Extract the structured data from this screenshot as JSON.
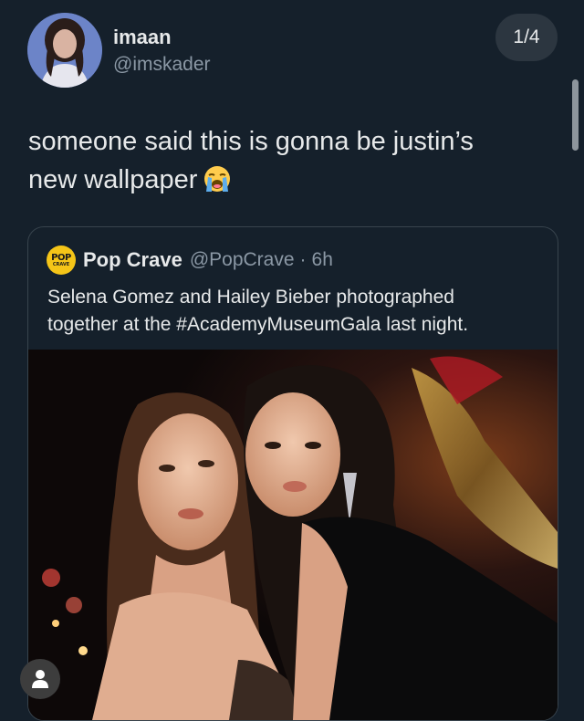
{
  "tweet": {
    "display_name": "imaan",
    "handle": "@imskader",
    "pager": "1/4",
    "text_line1": "someone said this is gonna be justin’s",
    "text_line2": "new wallpaper",
    "emoji": "loudly-crying-face"
  },
  "quote": {
    "logo_top": "POP",
    "logo_bottom": "CRAVE",
    "name": "Pop Crave",
    "handle": "@PopCrave",
    "separator": "·",
    "time": "6h",
    "text_line1": "Selena Gomez and Hailey Bieber photographed",
    "text_line2": "together at the #AcademyMuseumGala last night."
  },
  "icons": {
    "profile_fab": "person-icon"
  }
}
